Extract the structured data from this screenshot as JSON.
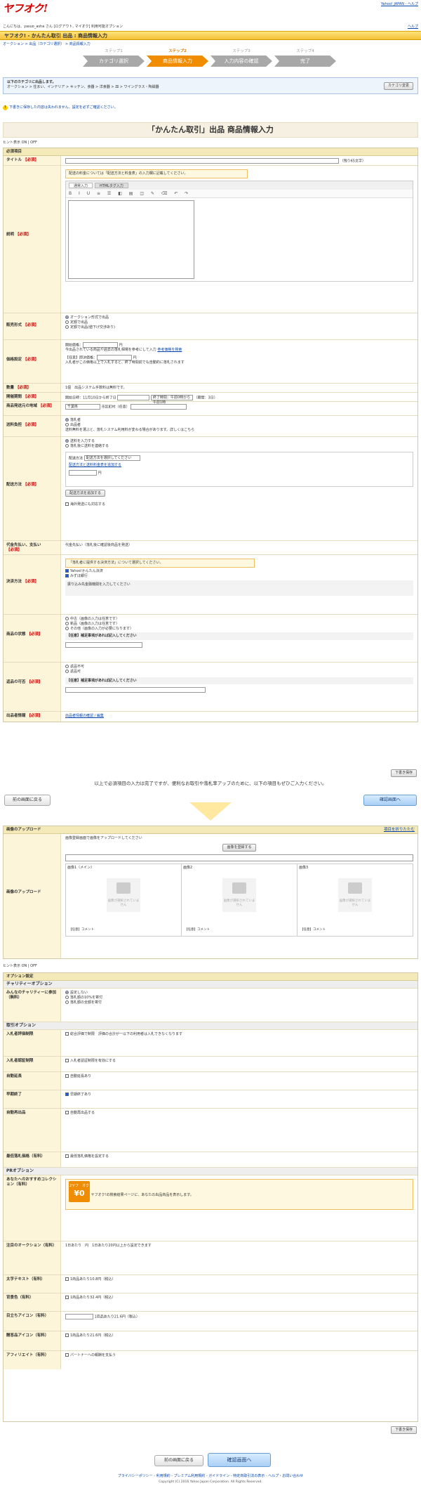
{
  "header": {
    "logo_main": "ヤフオク",
    "logo_mark": "!",
    "top_links": "Yahoo! JAPAN - ヘルプ",
    "greeting": "こんにちは、yasuo_asha さん [ログアウト, マイオク] 利用可能オプション",
    "help": "ヘルプ"
  },
  "titlebar": "ヤフオク! - かんたん取引 出品 : 商品情報入力",
  "breadcrumb": "オークション > 出品（カテゴリ選択） > 商品情報入力",
  "steps": [
    {
      "num": "ステップ1",
      "label": "カテゴリ選択"
    },
    {
      "num": "ステップ2",
      "label": "商品情報入力"
    },
    {
      "num": "ステップ3",
      "label": "入力内容の確認"
    },
    {
      "num": "ステップ4",
      "label": "完了"
    }
  ],
  "category": {
    "title": "以下のカテゴリに出品します。",
    "path": "オークション > 住まい、インテリア > キッチン、食器 > 洋食器 > 皿 > ワイングラス・陶磁器",
    "change_button": "カテゴリ変更"
  },
  "warn": "下書きに保存した内容は失われません、設定を必ずご確認ください。",
  "page_title": "「かんたん取引」出品 商品情報入力",
  "hint_toggle": "ヒント表示 ON | OFF",
  "required_section": "必須項目",
  "fields": {
    "title_label": "タイトル",
    "req_mark": "【必須】",
    "title_counter": "（残り65文字）",
    "desc_note": "配送の料金については「配送方法と料金表」の入力欄に記載してください。",
    "editor_tab1": "通常入力",
    "editor_tab2": "HTMLタグ入力",
    "editor_tools": "B I U ≡ ☰ ◧ ▤ ◫ ✎ ⌫ ↶ ↷",
    "desc_label": "説明",
    "sell_type_label": "販売形式",
    "sell_type_opts": [
      "オークション形式で出品",
      "定額で出品",
      "定額で出品(値下げ交渉あり)"
    ],
    "price_label": "価格設定",
    "start_price": "開始価格：",
    "yen": "円",
    "price_hint": "今出品されている商品や過去の落札相場を参考にして入力",
    "price_ref": "参考価格を検索",
    "buyout": "【任意】即決価格：",
    "buyout_note": "入札者がこの価格以上で入札すると、終了時間前でも自動的に落札されます",
    "qty_label": "数量",
    "qty_value": "1個　出品システム手数料は無料です。",
    "period_label": "開催期間",
    "period_value": "開始日時：11月10日から終了日",
    "period_end": "終了時間：午前0時から午前1時",
    "period_days": "（期間：3日）",
    "location_label": "商品発送元の地域",
    "location_value": "千葉県",
    "location_detail": "市区町村（任意）",
    "shipping_pay_label": "送料負担",
    "shipping_pay_opts": [
      "落札者",
      "出品者"
    ],
    "shipping_pay_note": "送料無料を選ぶと、落札システム利用料が変わる場合があります。詳しくはこちら",
    "delivery_label": "配送方法",
    "delivery_opts": [
      "送料を入力する",
      "落札後に送料を連絡する"
    ],
    "delivery_method": "配送方法",
    "delivery_select": "配送方法を選択してください",
    "delivery_add": "配送方法と送料料金表を追加する",
    "add_delivery_button": "配送方法を追加する",
    "overseas": "海外発送にも対応する",
    "proxy_label": "代金先払い、支払い",
    "proxy_value": "代金先払い（落札後に確認後商品を発送）",
    "payment_label": "決済方法",
    "payment_note": "「落札者に提供する決済方法」について選択してください。",
    "payment_opts": [
      "Yahoo!かんたん決済",
      "みずほ銀行"
    ],
    "payment_bank_note": "振り込み先金融機関を入力してください",
    "condition_label": "商品の状態",
    "condition_opts": [
      "中古（画像の入力は任意です）",
      "新品（画像の入力は任意です）",
      "その他（画像の入力が必要になります）"
    ],
    "condition_detail": "【任意】補足事項があれば記入してください",
    "returns_label": "返品の可否",
    "returns_opts": [
      "返品不可",
      "返品可"
    ],
    "returns_detail": "【任意】補足事項があれば記入してください",
    "info_label": "出品者情報",
    "info_value": "出品者情報の確認 / 編集"
  },
  "save_draft": "下書き保存",
  "mid_text": "以上で必須項目の入力は完了ですが、便利なお取引や落札率アップのために、以下の項目もぜひご入力ください。",
  "prev_button": "前の画面に戻る",
  "next_button": "確認画面へ",
  "image_section": "画像のアップロード",
  "image_section_help": "項目を折りたたむ",
  "image": {
    "label": "画像のアップロード",
    "intro": "画像登録画面で画像をアップロードしてください",
    "upload_button": "画像を登録する",
    "slot_names": [
      "画像1（メイン）",
      "画像2",
      "画像3"
    ],
    "slot_placeholder": "画像が選択されていません",
    "slot_caption": "【任意】コメント"
  },
  "option_section": "オプション設定",
  "charity_head": "チャリティーオプション",
  "charity_label": "みんなのチャリティーに参加（無料）",
  "charity_opts": [
    "設定しない",
    "落札額の10%を寄付",
    "落札額の全額を寄付"
  ],
  "bid_head": "取引オプション",
  "options": [
    {
      "label": "入札者評価制限",
      "value": "総合評価で制限　評価の合計が一以下の利用者は入札できなくなります"
    },
    {
      "label": "入札者認証制限",
      "value": "入札者認証制限を有効にする"
    },
    {
      "label": "自動延長",
      "value": "自動延長あり"
    },
    {
      "label": "早期終了",
      "value": "早期終了あり"
    },
    {
      "label": "自動再出品",
      "value": "自動再出品する"
    },
    {
      "label": "最低落札価格（有料）",
      "value": "最低落札価格を設定する"
    }
  ],
  "pr_head": "PRオプション",
  "pr": [
    {
      "label": "あなたへのおすすめコレクション（有料）",
      "value": "ヤフオク!の検索結果ページに、あなたの出品商品を表示します。"
    },
    {
      "label": "注目のオークション（有料）",
      "value": "1日あたり　円　1日あたり20円以上から設定できます"
    },
    {
      "label": "太字テキスト（有料）",
      "value": "1商品あたり10.8円（税込）"
    },
    {
      "label": "背景色（有料）",
      "value": "1商品あたり32.4円（税込）"
    },
    {
      "label": "目立ちアイコン（有料）",
      "value": "1商品あたり21.6円（税込）"
    },
    {
      "label": "贈答品アイコン（有料）",
      "value": "1商品あたり21.6円（税込）"
    },
    {
      "label": "アフィリエイト（有料）",
      "value": "パートナーへの報酬を支払う"
    }
  ],
  "coupon": {
    "top": "2ヤフ　オク",
    "amount": "¥0"
  },
  "footer_links": "プライバシーポリシー - 利用規約 - プレミアム利用規約 - ガイドライン - 特定商取引法の表示 - ヘルプ・お問い合わせ",
  "copyright": "Copyright (C) 2016 Yahoo Japan Corporation. All Rights Reserved."
}
